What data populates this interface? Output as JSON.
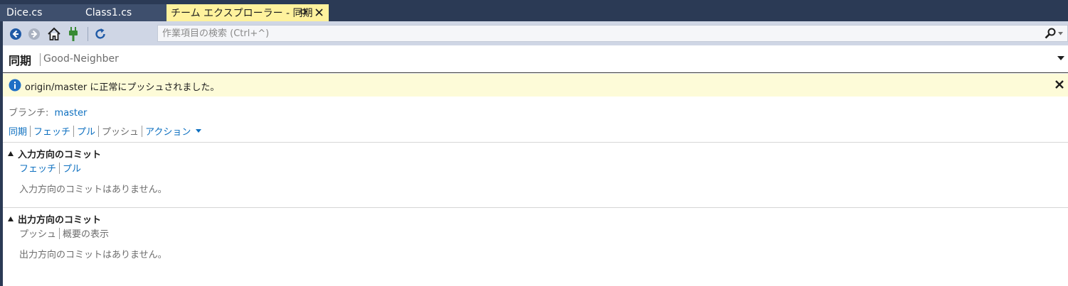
{
  "tabs": [
    {
      "label": "Dice.cs"
    },
    {
      "label": "Class1.cs"
    },
    {
      "label": "チーム エクスプローラー - 同期"
    }
  ],
  "toolbar": {
    "search_placeholder": "作業項目の検索 (Ctrl+^)"
  },
  "header": {
    "title": "同期",
    "repository": "Good-Neighber"
  },
  "info": {
    "message": "origin/master に正常にプッシュされました。"
  },
  "branch": {
    "label": "ブランチ:",
    "name": "master"
  },
  "actions": {
    "sync": "同期",
    "fetch": "フェッチ",
    "pull": "プル",
    "push": "プッシュ",
    "action": "アクション"
  },
  "incoming": {
    "title": "入力方向のコミット",
    "fetch": "フェッチ",
    "pull": "プル",
    "empty": "入力方向のコミットはありません。"
  },
  "outgoing": {
    "title": "出力方向のコミット",
    "push": "プッシュ",
    "summary": "概要の表示",
    "empty": "出力方向のコミットはありません。"
  },
  "colors": {
    "accent_link": "#0e70c0",
    "tab_active": "#fff29d",
    "info_bar": "#fdfbd8",
    "toolbar": "#cfd6e5"
  }
}
